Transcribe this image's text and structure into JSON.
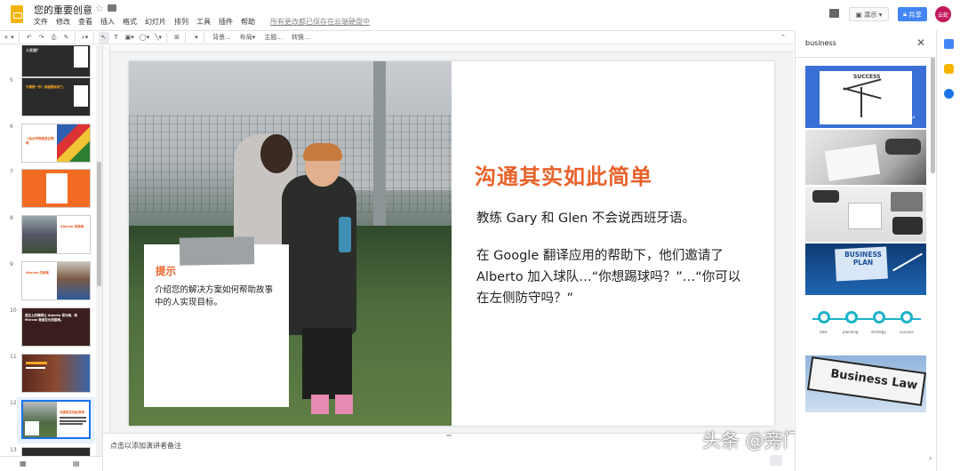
{
  "app": {
    "doc_title": "您的重要创意",
    "menu": [
      "文件",
      "修改",
      "查看",
      "插入",
      "格式",
      "幻灯片",
      "排列",
      "工具",
      "插件",
      "帮助"
    ],
    "save_status": "所有更改都已保存在云端硬盘中",
    "present_label": "演示",
    "share_label": "共享",
    "avatar_initials": "云蛇"
  },
  "toolbar": {
    "background_label": "背景...",
    "layout_label": "布局",
    "theme_label": "主题...",
    "transition_label": "转换..."
  },
  "filmstrip": {
    "slides": [
      {
        "num": "",
        "text": "人交流？",
        "theme": "dark"
      },
      {
        "num": "5",
        "text": "只需要一秒！都被翻译成了。",
        "theme": "dark"
      },
      {
        "num": "6",
        "text": "一起合作跨越语言障碍",
        "theme": "photo-flags"
      },
      {
        "num": "7",
        "text": "",
        "theme": "orange"
      },
      {
        "num": "8",
        "text": "Alberto 的故事",
        "theme": "photo"
      },
      {
        "num": "9",
        "text": "Marcos 的故事",
        "theme": "photo-person"
      },
      {
        "num": "10",
        "text": "语言上的障碍让 Alberto 很为难，和 Marcos 做朋友也很困难。",
        "theme": "dark-red"
      },
      {
        "num": "11",
        "text": "",
        "theme": "photo-man"
      },
      {
        "num": "12",
        "text": "沟通其实如此简单",
        "theme": "current"
      },
      {
        "num": "13",
        "text": "",
        "theme": "dark"
      }
    ]
  },
  "slide": {
    "title": "沟通其实如此简单",
    "para1": "教练 Gary 和 Glen 不会说西班牙语。",
    "para2": "在 Google 翻译应用的帮助下，他们邀请了 Alberto 加入球队…“你想踢球吗？”…“你可以在左侧防守吗？”",
    "card_title": "提示",
    "card_body": "介绍您的解决方案如何帮助故事中的人实现目标。"
  },
  "notes": {
    "placeholder": "点击以添加演讲者备注"
  },
  "explore": {
    "query": "business",
    "results": [
      "SUCCESS",
      "BUSINESS PLAN",
      "Business Law"
    ],
    "timeline_labels": [
      "idea",
      "planning",
      "strategy",
      "success"
    ]
  },
  "watermark": "头条 @旁门左道PPT",
  "colors": {
    "accent_orange": "#e8622a",
    "share_blue": "#4285f4",
    "selection_blue": "#1a73e8",
    "logo_yellow": "#f4b400"
  }
}
